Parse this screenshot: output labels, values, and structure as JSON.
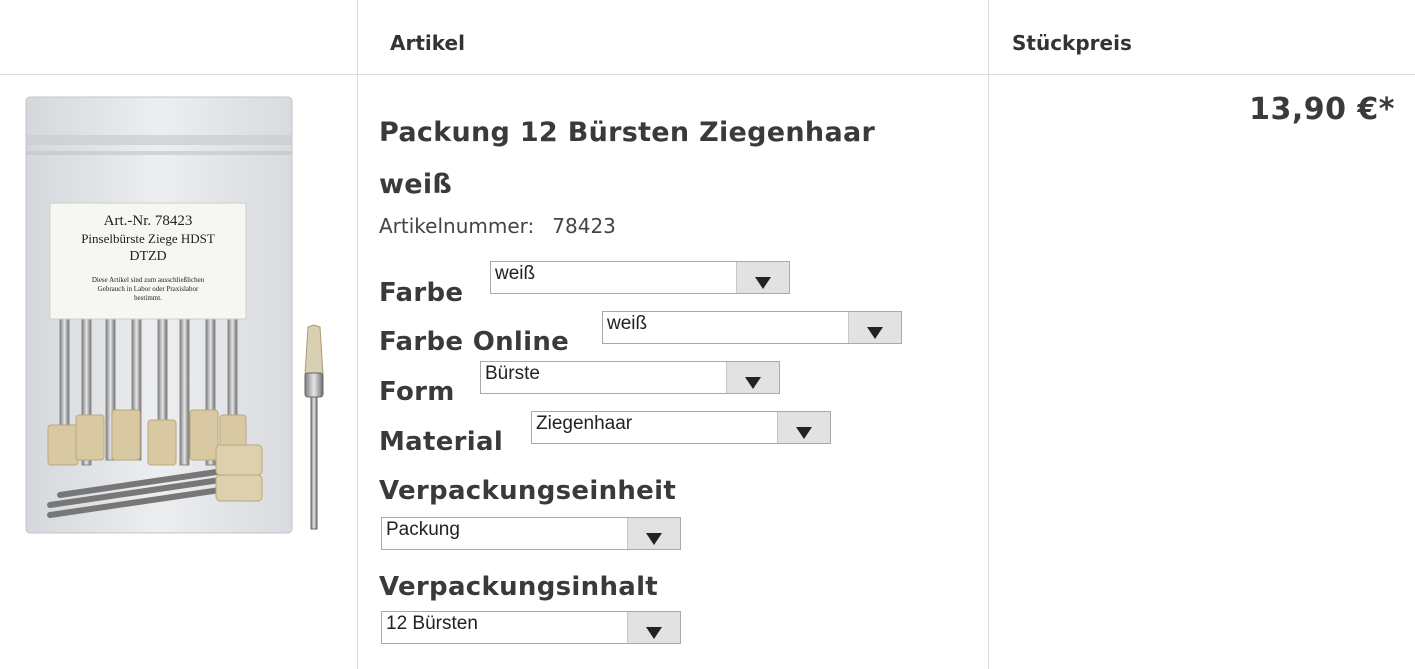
{
  "table": {
    "headers": [
      "",
      "Artikel",
      "Stückpreis"
    ]
  },
  "product": {
    "name": "Packung 12 Bürsten Ziegenhaar weiß",
    "article_number_label": "Artikelnummer:",
    "article_number": "78423",
    "price": "13,90 €*",
    "image_label": {
      "line1": "Art.-Nr. 78423",
      "line2": "Pinselbürste Ziege HDST",
      "line3": "DTZD",
      "line4": "Diese Artikel sind zum ausschließlichen",
      "line5": "Gebrauch in Labor oder Praxislabor",
      "line6": "bestimmt."
    }
  },
  "options": [
    {
      "label": "Farbe",
      "value": "weiß"
    },
    {
      "label": "Farbe Online",
      "value": "weiß"
    },
    {
      "label": "Form",
      "value": "Bürste"
    },
    {
      "label": "Material",
      "value": "Ziegenhaar"
    },
    {
      "label": "Verpackungseinheit",
      "value": "Packung"
    },
    {
      "label": "Verpackungsinhalt",
      "value": "12 Bürsten"
    }
  ],
  "icons": {
    "dropdown": "triangle-down-icon"
  }
}
